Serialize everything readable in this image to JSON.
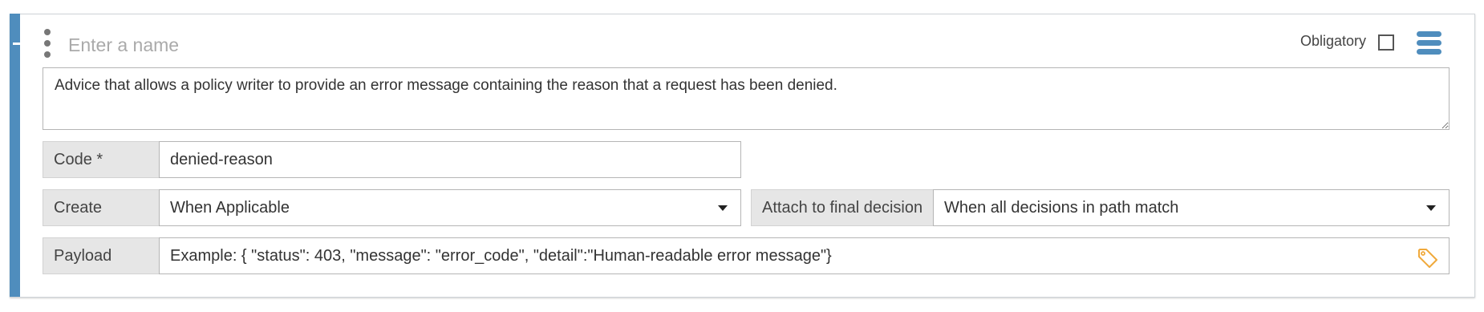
{
  "rule": {
    "name_placeholder": "Enter a name",
    "obligatory_label": "Obligatory",
    "obligatory_checked": false,
    "description": "Advice that allows a policy writer to provide an error message containing the reason that a request has been denied.",
    "code": {
      "label": "Code *",
      "value": "denied-reason"
    },
    "create": {
      "label": "Create",
      "selected": "When Applicable"
    },
    "attach": {
      "label": "Attach to final decision",
      "selected": "When all decisions in path match"
    },
    "payload": {
      "label": "Payload",
      "value": "Example: { \"status\": 403, \"message\": \"error_code\", \"detail\":\"Human-readable error message\"}"
    }
  },
  "icons": {
    "drag_handle": "vertical-ellipsis-icon",
    "menu": "hamburger-menu-icon",
    "payload_tag": "tag-icon"
  },
  "colors": {
    "accent": "#4f8dbd",
    "label_background": "#e6e6e6",
    "tag_icon": "#f0a93b"
  }
}
